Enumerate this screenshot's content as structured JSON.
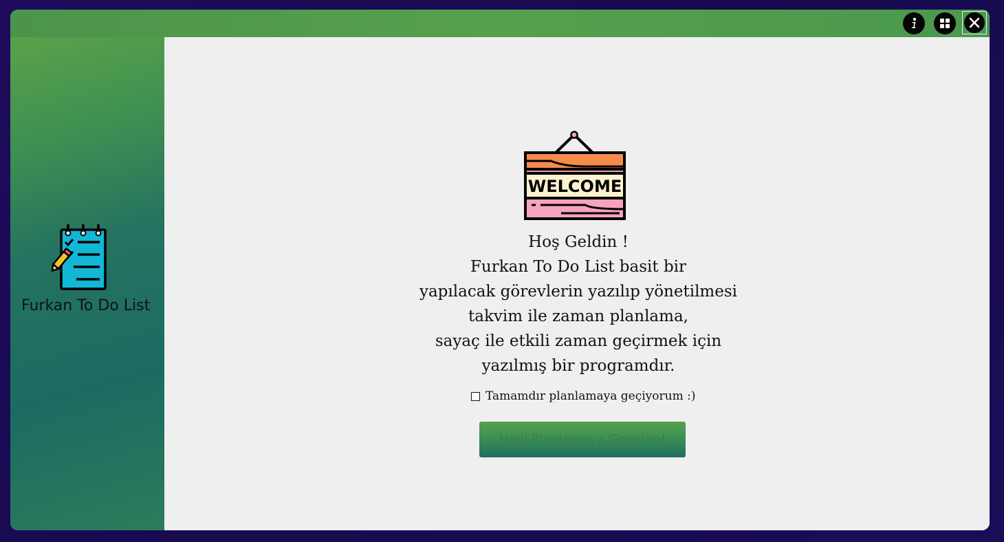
{
  "window": {
    "buttons": {
      "info_icon": "info-icon",
      "maximize_icon": "grid-icon",
      "close_icon": "close-icon"
    }
  },
  "sidebar": {
    "app_name": "Furkan To Do List",
    "logo_icon": "checklist-notepad-icon"
  },
  "main": {
    "sign_text": "WELCOME",
    "message_lines": [
      "Hoş Geldin !",
      "Furkan To Do List basit bir",
      "yapılacak görevlerin yazılıp yönetilmesi",
      "takvim ile zaman planlama,",
      "sayaç ile etkili zaman geçirmek için",
      "yazılmış bir programdır."
    ],
    "confirm_checkbox": {
      "label": "Tamamdır planlamaya geçiyorum :)",
      "checked": false
    },
    "start_button_label": "Hadi Planlamaya Geçelim!"
  },
  "colors": {
    "titlebar": "#4f9a4c",
    "sidebar_top": "#5aa24a",
    "sidebar_bottom": "#1b6b62",
    "content_bg": "#efefef",
    "outer_bg": "#1b0b56"
  }
}
